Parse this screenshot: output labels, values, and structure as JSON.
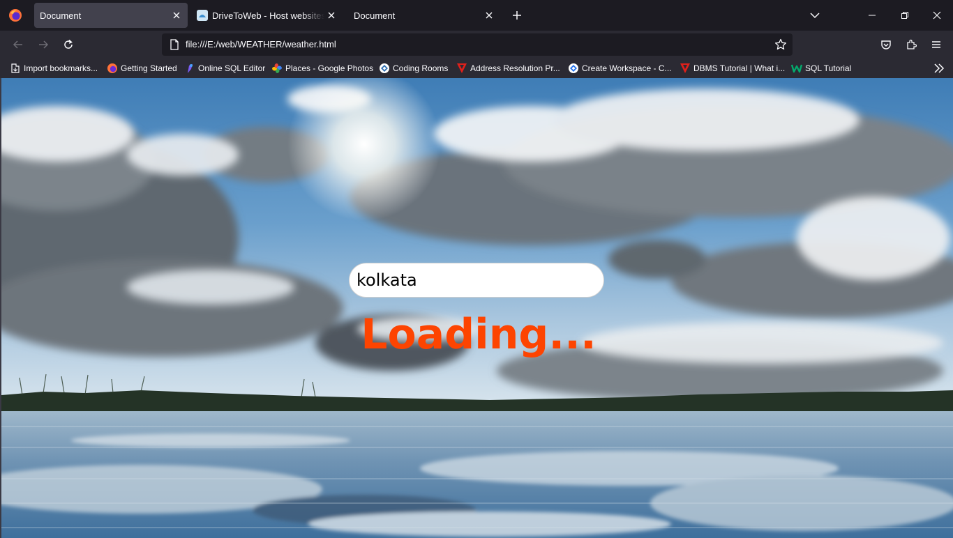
{
  "browser": {
    "tabs": [
      {
        "title": "Document",
        "active": true
      },
      {
        "title": "DriveToWeb - Host websites on",
        "active": false
      },
      {
        "title": "Document",
        "active": false
      }
    ],
    "url": "file:///E:/web/WEATHER/weather.html"
  },
  "bookmarks": [
    {
      "label": "Import bookmarks...",
      "icon": "import-icon"
    },
    {
      "label": "Getting Started",
      "icon": "firefox-icon"
    },
    {
      "label": "Online SQL Editor",
      "icon": "sql-editor-icon"
    },
    {
      "label": "Places - Google Photos",
      "icon": "google-photos-icon"
    },
    {
      "label": "Coding Rooms",
      "icon": "coding-rooms-icon"
    },
    {
      "label": "Address Resolution Pr...",
      "icon": "red-v-icon"
    },
    {
      "label": "Create Workspace - C...",
      "icon": "workspace-icon"
    },
    {
      "label": "DBMS Tutorial | What i...",
      "icon": "red-v-icon"
    },
    {
      "label": "SQL Tutorial",
      "icon": "w3-icon"
    }
  ],
  "page": {
    "search_value": "kolkata",
    "status_text": "Loading..."
  },
  "colors": {
    "status_text": "#fd4401",
    "tabstrip_bg": "#1c1b22",
    "toolbar_bg": "#2b2a33",
    "active_tab_bg": "#42414d"
  }
}
